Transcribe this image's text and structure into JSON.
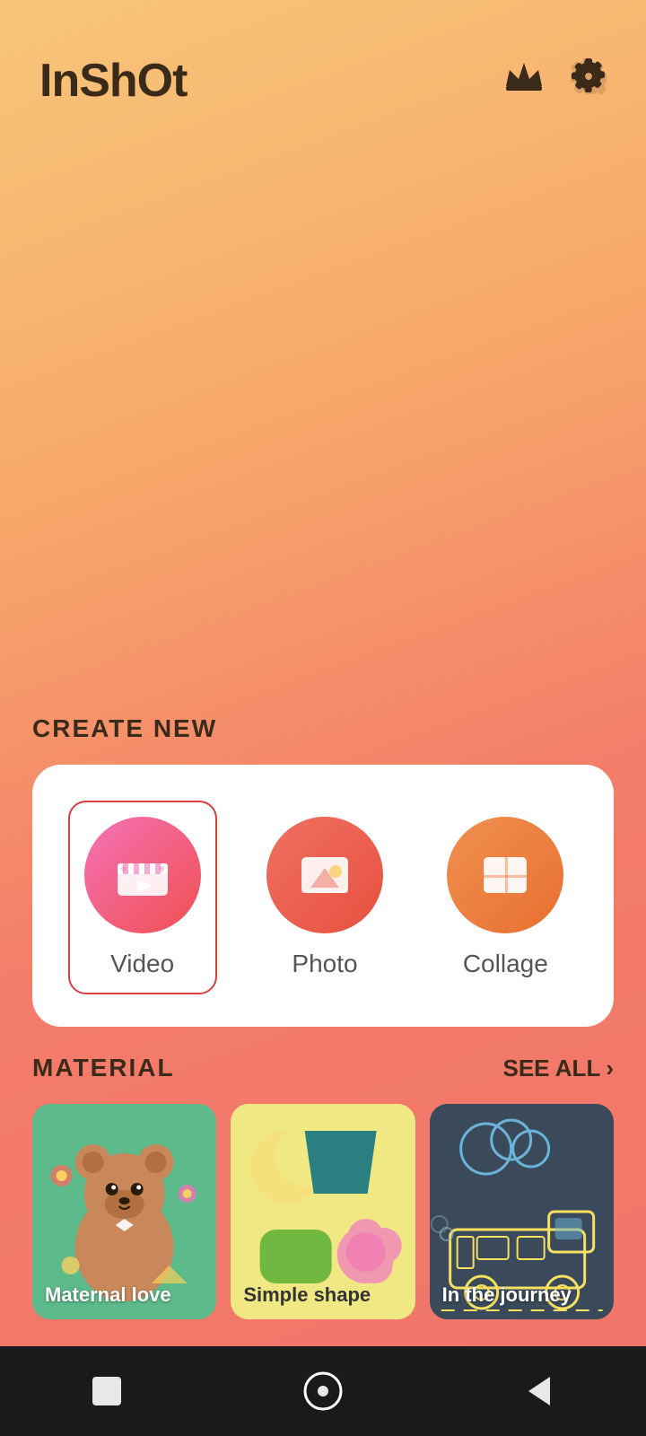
{
  "app": {
    "logo": "InShOt"
  },
  "header": {
    "crown_label": "crown",
    "settings_label": "settings"
  },
  "create_new": {
    "section_label": "CREATE NEW",
    "items": [
      {
        "id": "video",
        "label": "Video",
        "selected": true
      },
      {
        "id": "photo",
        "label": "Photo",
        "selected": false
      },
      {
        "id": "collage",
        "label": "Collage",
        "selected": false
      }
    ]
  },
  "material": {
    "section_label": "MATERIAL",
    "see_all_label": "SEE ALL",
    "cards": [
      {
        "id": "maternal-love",
        "label": "Maternal love",
        "bg": "green"
      },
      {
        "id": "simple-shape",
        "label": "Simple shape",
        "bg": "yellow"
      },
      {
        "id": "in-the-journey",
        "label": "In the journey",
        "bg": "dark"
      }
    ]
  },
  "navbar": {
    "square_label": "square",
    "home_label": "home",
    "back_label": "back"
  }
}
